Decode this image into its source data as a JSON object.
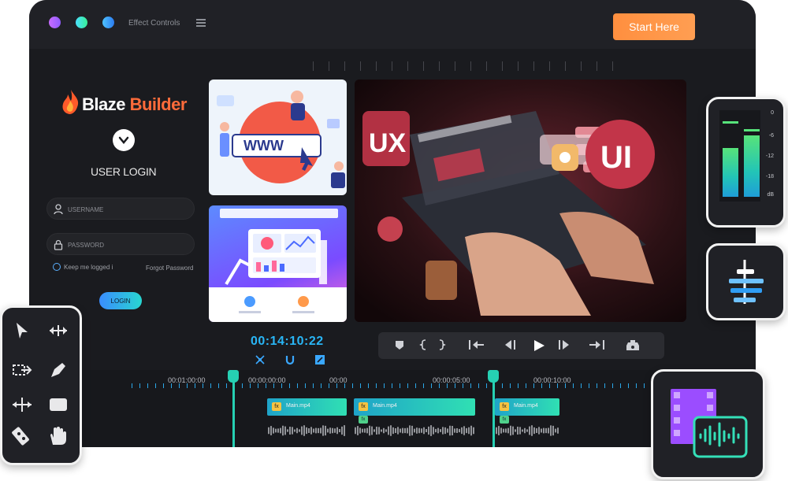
{
  "topbar": {
    "effect_controls": "Effect Controls",
    "start_button": "Start Here"
  },
  "login": {
    "brand_a": "Blaze ",
    "brand_b": "Builder",
    "title": "USER LOGIN",
    "username_placeholder": "USERNAME",
    "password_placeholder": "PASSWORD",
    "keep_logged": "Keep me logged i",
    "forgot": "Forgot Password",
    "button": "LOGIN"
  },
  "thumbs": {
    "www": "WWW",
    "ux": "UX",
    "ui": "UI"
  },
  "editor": {
    "timecode": "00:14:10:22"
  },
  "timeline": {
    "labels": [
      "00:01:00:00",
      "00:00:00:00",
      "00:00",
      "00:00:05:00",
      "00:00:10:00"
    ],
    "fx": "fx",
    "clips": [
      "Main.mp4",
      "Main.mp4",
      "Main.mp4"
    ]
  },
  "meter": {
    "db": [
      "0",
      "-6",
      "-12",
      "-18",
      "dB"
    ],
    "levels": [
      0.62,
      0.78
    ]
  },
  "colors": {
    "accent_orange": "#ff9147",
    "accent_blue": "#29b6f6",
    "accent_teal": "#26d0b3",
    "window_bg": "#1a1b1f"
  }
}
